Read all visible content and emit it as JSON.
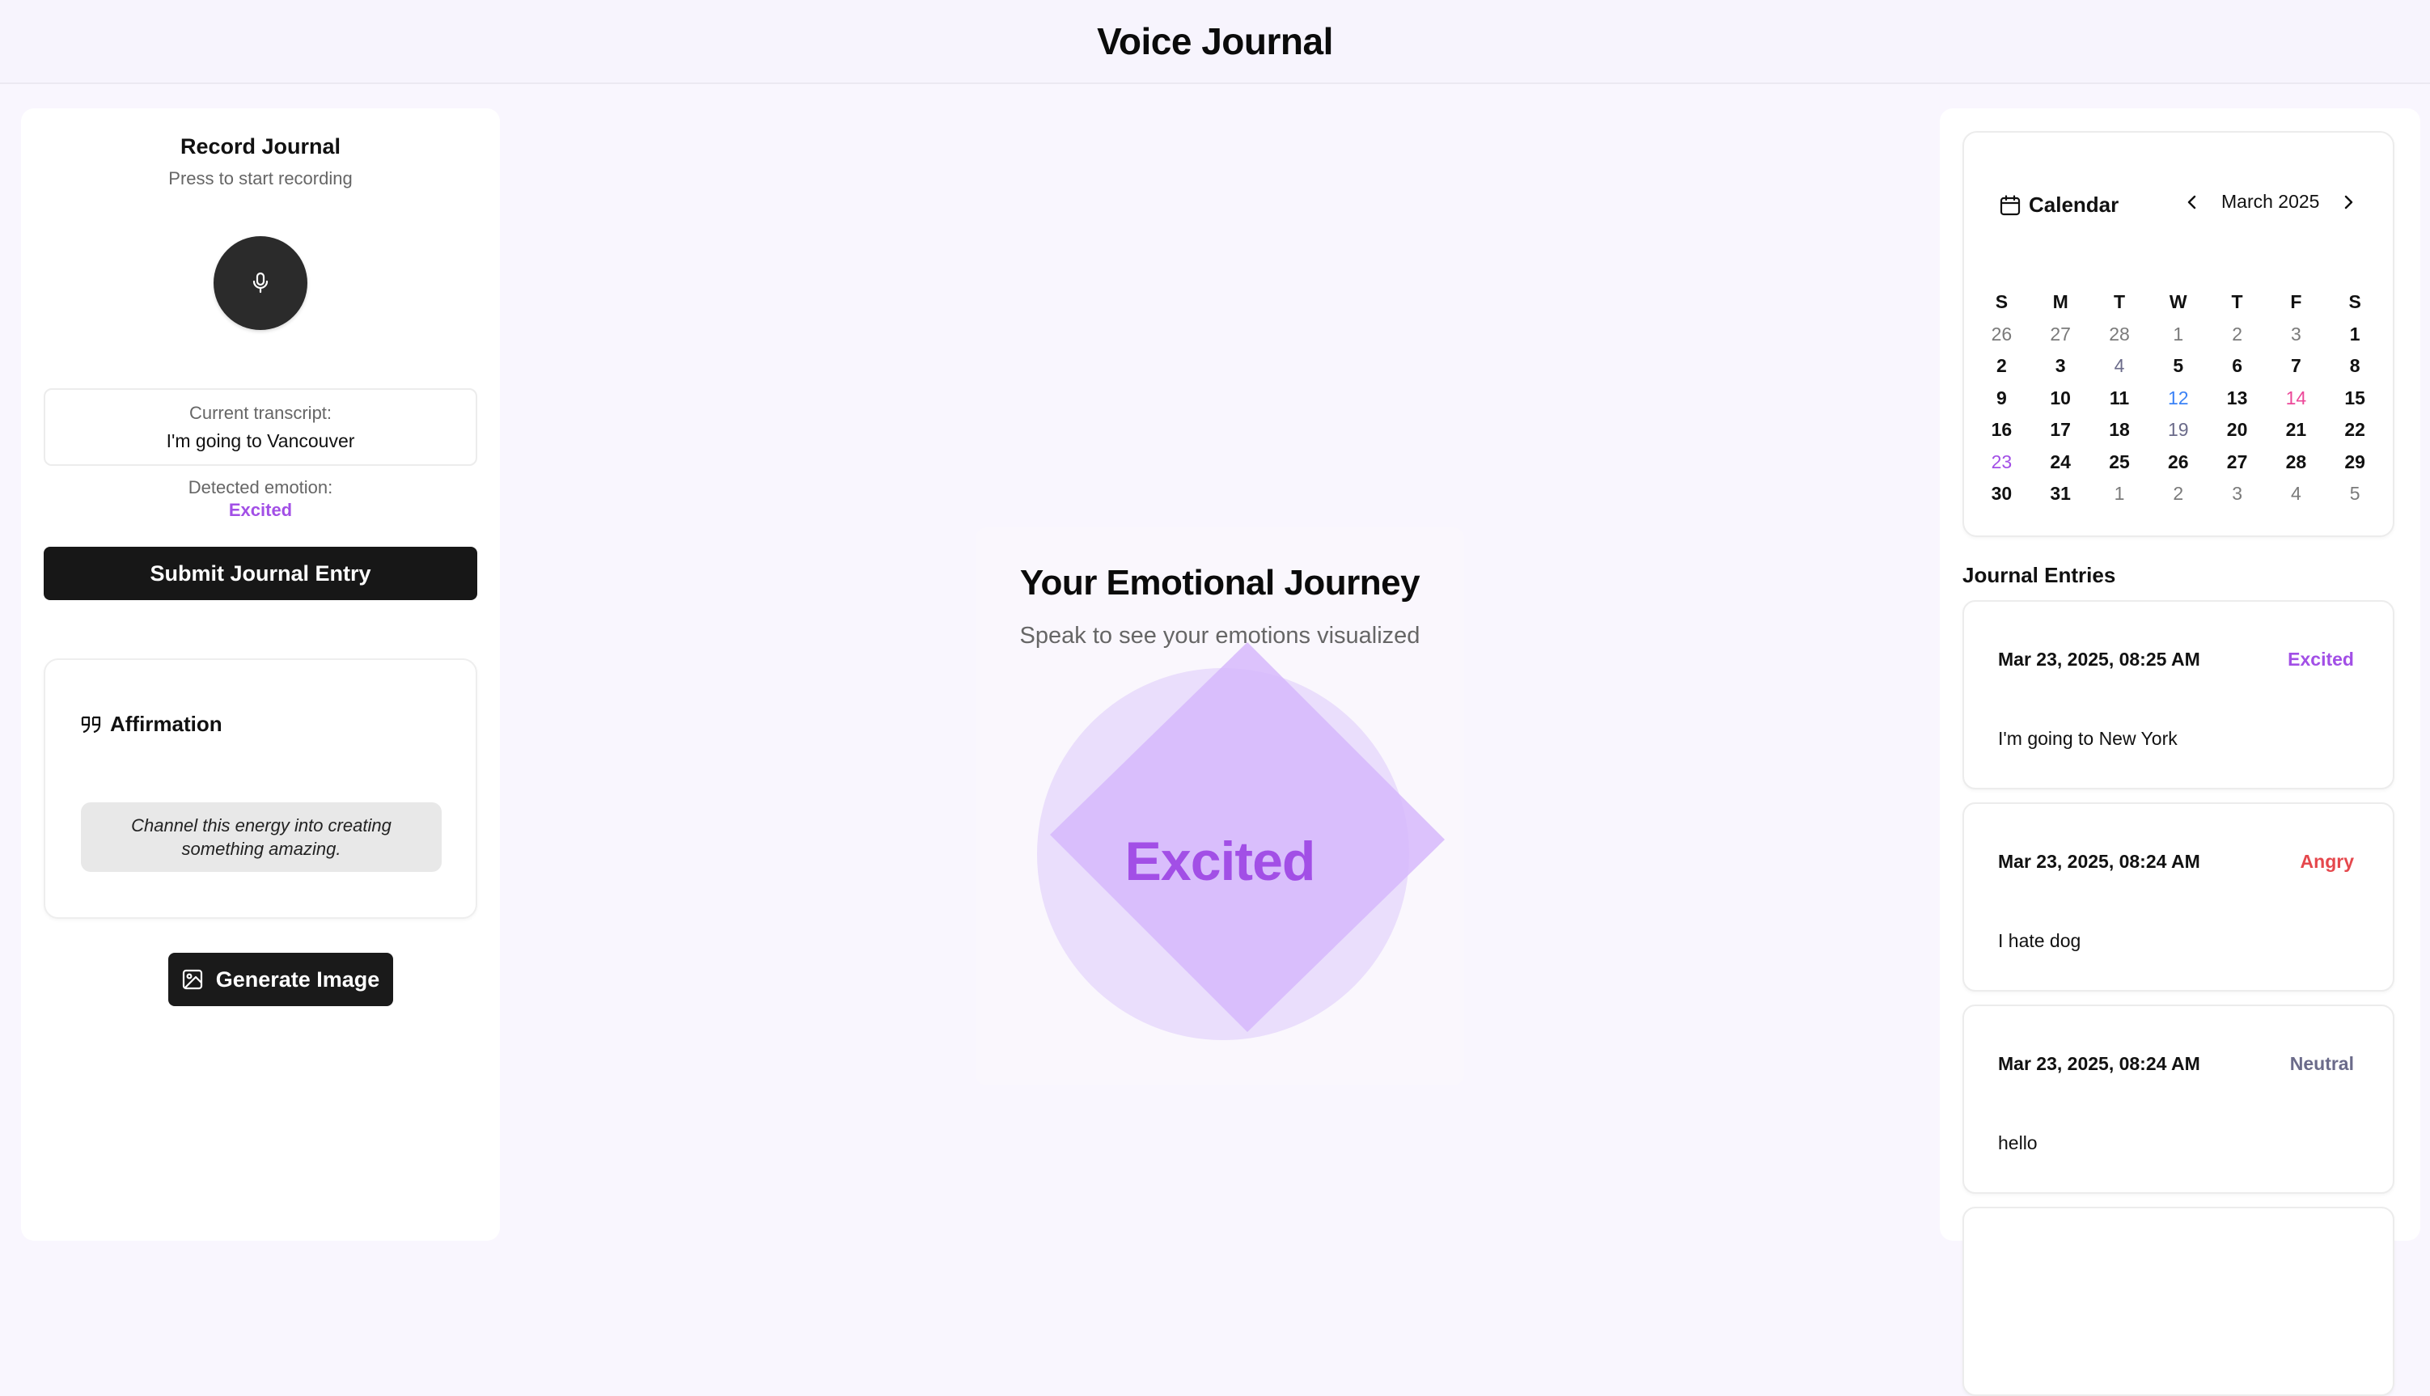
{
  "app": {
    "title": "Voice Journal"
  },
  "recorder": {
    "title": "Record Journal",
    "subtitle": "Press to start recording",
    "transcript_label": "Current transcript:",
    "transcript": "I'm going to Vancouver",
    "emotion_label": "Detected emotion:",
    "emotion": "Excited",
    "submit_label": "Submit Journal Entry"
  },
  "affirmation": {
    "title": "Affirmation",
    "text": "Channel this energy into creating something amazing."
  },
  "generate": {
    "label": "Generate Image"
  },
  "journey": {
    "title": "Your Emotional Journey",
    "subtitle": "Speak to see your emotions visualized",
    "emotion": "Excited"
  },
  "calendar": {
    "title": "Calendar",
    "month": "March 2025",
    "weekdays": [
      "S",
      "M",
      "T",
      "W",
      "T",
      "F",
      "S"
    ],
    "weeks": [
      [
        {
          "d": "26",
          "o": true
        },
        {
          "d": "27",
          "o": true
        },
        {
          "d": "28",
          "o": true
        },
        {
          "d": "1",
          "o": true
        },
        {
          "d": "2",
          "o": true
        },
        {
          "d": "3",
          "o": true
        },
        {
          "d": "1"
        }
      ],
      [
        {
          "d": "2"
        },
        {
          "d": "3"
        },
        {
          "d": "4",
          "c": "#6b6b8a"
        },
        {
          "d": "5"
        },
        {
          "d": "6"
        },
        {
          "d": "7"
        },
        {
          "d": "8"
        }
      ],
      [
        {
          "d": "9"
        },
        {
          "d": "10"
        },
        {
          "d": "11"
        },
        {
          "d": "12",
          "c": "#3b82f6"
        },
        {
          "d": "13"
        },
        {
          "d": "14",
          "c": "#ec4899"
        },
        {
          "d": "15"
        }
      ],
      [
        {
          "d": "16"
        },
        {
          "d": "17"
        },
        {
          "d": "18"
        },
        {
          "d": "19",
          "c": "#6b6b8a"
        },
        {
          "d": "20"
        },
        {
          "d": "21"
        },
        {
          "d": "22"
        }
      ],
      [
        {
          "d": "23",
          "c": "#a24fe6"
        },
        {
          "d": "24"
        },
        {
          "d": "25"
        },
        {
          "d": "26"
        },
        {
          "d": "27"
        },
        {
          "d": "28"
        },
        {
          "d": "29"
        }
      ],
      [
        {
          "d": "30"
        },
        {
          "d": "31"
        },
        {
          "d": "1",
          "o": true
        },
        {
          "d": "2",
          "o": true
        },
        {
          "d": "3",
          "o": true
        },
        {
          "d": "4",
          "o": true
        },
        {
          "d": "5",
          "o": true
        }
      ]
    ]
  },
  "entries": {
    "title": "Journal Entries",
    "items": [
      {
        "date": "Mar 23, 2025, 08:25 AM",
        "emotion": "Excited",
        "color": "#a24fe6",
        "text": "I'm going to New York"
      },
      {
        "date": "Mar 23, 2025, 08:24 AM",
        "emotion": "Angry",
        "color": "#e5484d",
        "text": "I hate dog"
      },
      {
        "date": "Mar 23, 2025, 08:24 AM",
        "emotion": "Neutral",
        "color": "#6b6b8a",
        "text": "hello"
      }
    ]
  },
  "colors": {
    "accent": "#a24fe6",
    "circle": "#e8dafc",
    "diamond": "#d6b8fb"
  }
}
